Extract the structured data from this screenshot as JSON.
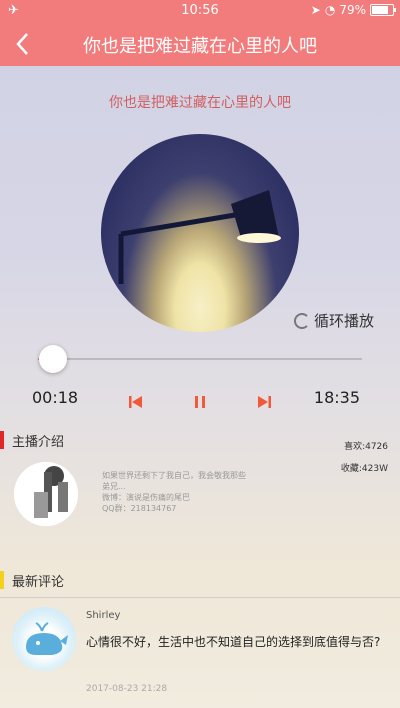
{
  "status_bar": {
    "time": "10:56",
    "battery": "79%"
  },
  "nav": {
    "back_icon": "chevron-left-icon",
    "title": "你也是把难过藏在心里的人吧"
  },
  "player": {
    "song_title": "你也是把难过藏在心里的人吧",
    "loop_mode_label": "循环播放",
    "current_time": "00:18",
    "total_time": "18:35",
    "progress": 0.016
  },
  "anchor": {
    "heading": "主播介绍",
    "likes": "喜欢:4726",
    "favorites": "收藏:423W",
    "desc_line1": "如果世界还剩下了我自己，我会敬我那些",
    "desc_line2": "弟兄...",
    "desc_line3": "微博：演说是伤痛的尾巴",
    "desc_line4": "QQ群：218134767"
  },
  "comments": {
    "heading": "最新评论",
    "items": [
      {
        "user": "Shirley",
        "text": "心情很不好，生活中也不知道自己的选择到底值得与否?",
        "time": "2017-08-23 21:28"
      }
    ]
  },
  "colors": {
    "accent": "#f27b7b",
    "control": "#f05a3a",
    "section_red": "#e02828",
    "section_yellow": "#f2d21c"
  }
}
